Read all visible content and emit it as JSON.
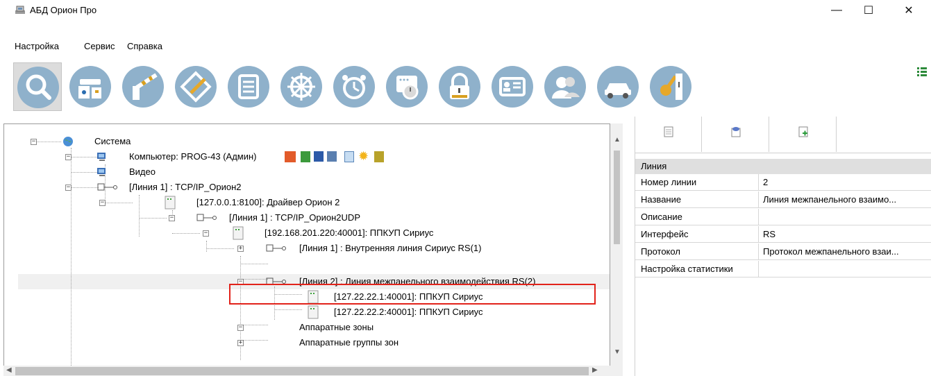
{
  "window": {
    "title": "АБД Орион Про",
    "app_icon": "database-icon",
    "minimize": "—",
    "maximize": "☐",
    "close": "✕"
  },
  "menu": {
    "items": [
      "Настройка",
      "Сервис",
      "Справка"
    ]
  },
  "toolbar": {
    "buttons": [
      {
        "icon": "search-icon",
        "active": true
      },
      {
        "icon": "camera-device-icon"
      },
      {
        "icon": "barrier-gate-icon"
      },
      {
        "icon": "plan-edit-icon"
      },
      {
        "icon": "document-list-icon"
      },
      {
        "icon": "helm-wheel-icon"
      },
      {
        "icon": "alarm-clock-icon"
      },
      {
        "icon": "schedule-board-icon"
      },
      {
        "icon": "padlock-icon"
      },
      {
        "icon": "id-card-icon"
      },
      {
        "icon": "users-icon"
      },
      {
        "icon": "car-icon"
      },
      {
        "icon": "key-icon"
      }
    ],
    "side_icon": "list-view-icon"
  },
  "tree": {
    "nodes": [
      {
        "label": "Система",
        "icon": "globe-icon",
        "expander": "−"
      },
      {
        "label": "Компьютер: PROG-43 (Админ)",
        "icon": "computer-icon",
        "expander": "−"
      },
      {
        "label": "Видео",
        "icon": "computer-icon",
        "expander": ""
      },
      {
        "label": "[Линия 1] : TCP/IP_Орион2",
        "icon": "line-connector-icon",
        "expander": "−"
      },
      {
        "label": "[127.0.0.1:8100]: Драйвер Орион 2",
        "icon": "device-icon",
        "expander": "−"
      },
      {
        "label": "[Линия 1] : TCP/IP_Орион2UDP",
        "icon": "line-connector-icon",
        "expander": "−"
      },
      {
        "label": "[192.168.201.220:40001]: ППКУП Сириус",
        "icon": "device-icon",
        "expander": "−"
      },
      {
        "label": "[Линия 1] : Внутренняя линия Сириус RS(1)",
        "icon": "line-connector-icon",
        "expander": "+"
      },
      {
        "label": "[Линия 2] : Линия межпанельного взаимодействия RS(2)",
        "icon": "line-connector-icon",
        "expander": "−",
        "selected": true
      },
      {
        "label": "[127.22.22.1:40001]: ППКУП Сириус",
        "icon": "device-icon",
        "expander": ""
      },
      {
        "label": "[127.22.22.2:40001]: ППКУП Сириус",
        "icon": "device-icon",
        "expander": ""
      },
      {
        "label": "Аппаратные зоны",
        "icon": "",
        "expander": "−"
      },
      {
        "label": "Аппаратные группы зон",
        "icon": "",
        "expander": "+"
      }
    ],
    "computer_status_icons": [
      "fire-icon",
      "module-icon",
      "monitor-icon",
      "server-icon",
      "report-icon",
      "sun-icon",
      "key-folder-icon"
    ]
  },
  "right_panel": {
    "tabs": [
      {
        "icon": "page-icon",
        "active": true
      },
      {
        "icon": "comment-page-icon"
      },
      {
        "icon": "add-page-icon"
      }
    ],
    "section": "Линия",
    "properties": [
      {
        "name": "Номер линии",
        "value": "2"
      },
      {
        "name": "Название",
        "value": "Линия межпанельного взаимо..."
      },
      {
        "name": "Описание",
        "value": ""
      },
      {
        "name": "Интерфейс",
        "value": "RS"
      },
      {
        "name": "Протокол",
        "value": "Протокол межпанельного взаи..."
      },
      {
        "name": "Настройка статистики",
        "value": ""
      }
    ]
  },
  "colors": {
    "toolbar_circle": "#8fb1cb",
    "toolbar_circle_inner": "#ffffff",
    "highlight_box": "#e2221a",
    "header_bg": "#dfdfdf"
  }
}
